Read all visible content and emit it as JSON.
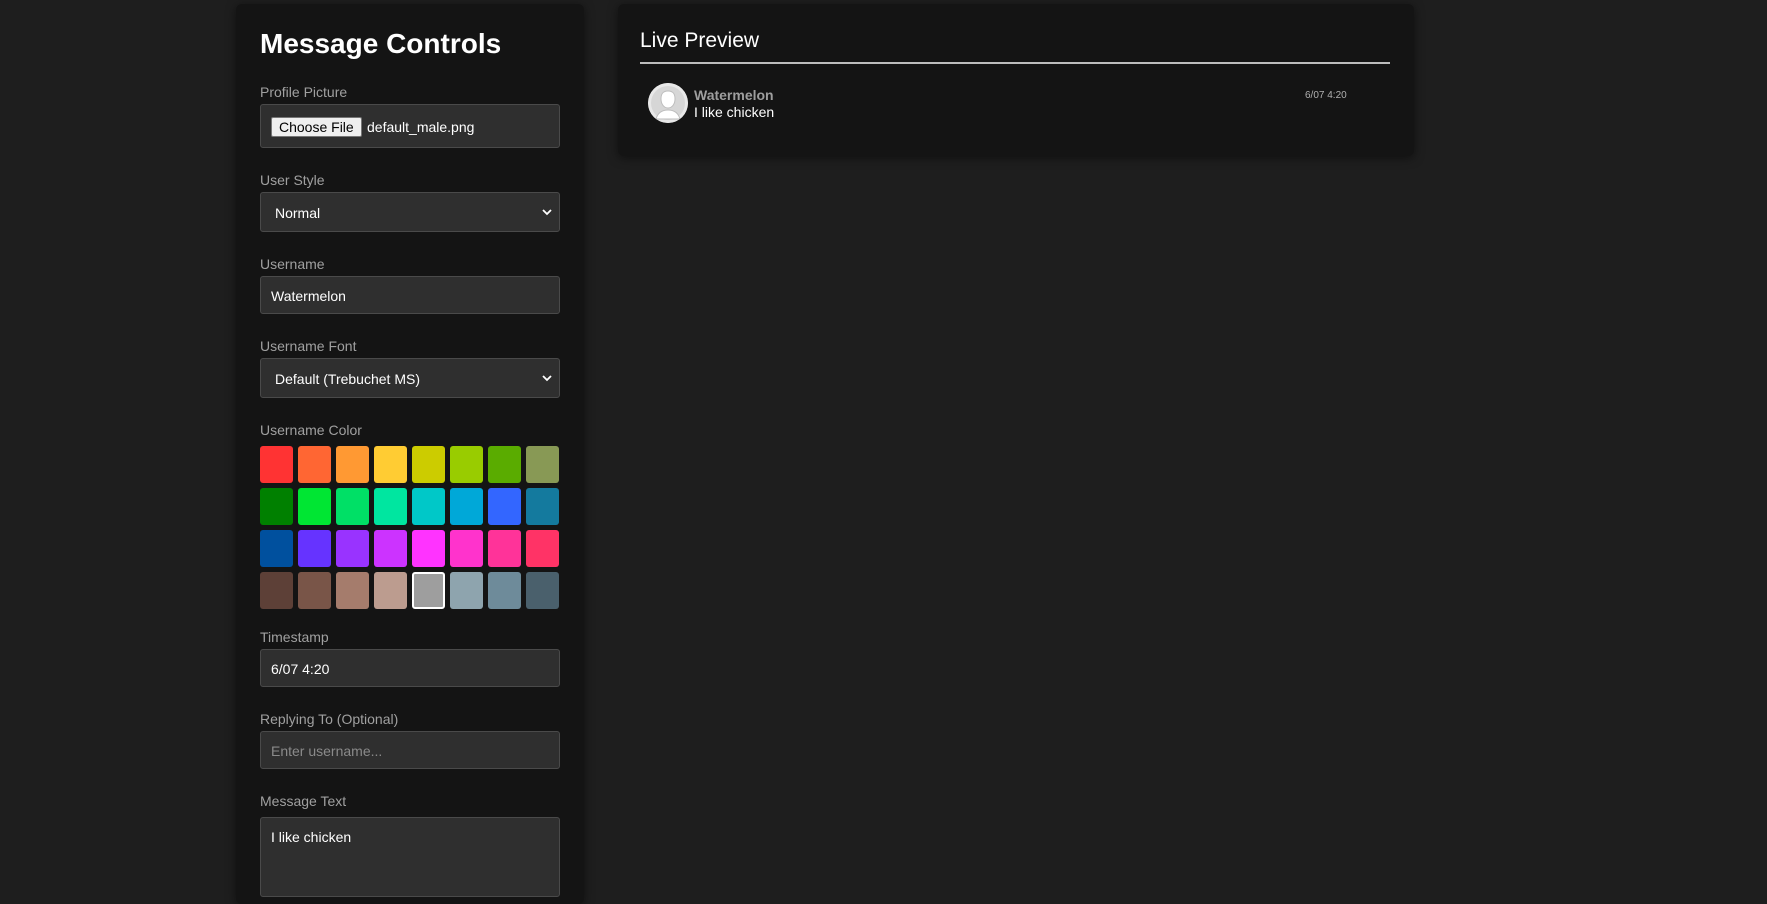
{
  "controls": {
    "title": "Message Controls",
    "profile_picture": {
      "label": "Profile Picture",
      "button_label": "Choose File",
      "file_name": "default_male.png"
    },
    "user_style": {
      "label": "User Style",
      "value": "Normal"
    },
    "username": {
      "label": "Username",
      "value": "Watermelon"
    },
    "username_font": {
      "label": "Username Font",
      "value": "Default (Trebuchet MS)"
    },
    "username_color": {
      "label": "Username Color",
      "selected": "#9e9e9e",
      "swatches": [
        "#ff3333",
        "#ff6633",
        "#ff9933",
        "#ffcc33",
        "#cccc00",
        "#99cc00",
        "#5aac00",
        "#889955",
        "#008000",
        "#00e633",
        "#00e066",
        "#00e6a0",
        "#00c8c8",
        "#00a8d8",
        "#3366ff",
        "#147a9e",
        "#00509e",
        "#6633ff",
        "#9933ff",
        "#cc33ff",
        "#ff33ff",
        "#ff33cc",
        "#ff3399",
        "#ff3366",
        "#5d4037",
        "#795548",
        "#a57c6c",
        "#bc9c8f",
        "#9e9e9e",
        "#8ea4ae",
        "#6e8b9a",
        "#4a606c"
      ]
    },
    "timestamp": {
      "label": "Timestamp",
      "value": "6/07 4:20"
    },
    "replying_to": {
      "label": "Replying To (Optional)",
      "placeholder": "Enter username..."
    },
    "message_text": {
      "label": "Message Text",
      "value": "I like chicken"
    }
  },
  "preview": {
    "title": "Live Preview",
    "message": {
      "username": "Watermelon",
      "text": "I like chicken",
      "timestamp": "6/07 4:20",
      "username_color": "#9e9e9e"
    }
  }
}
